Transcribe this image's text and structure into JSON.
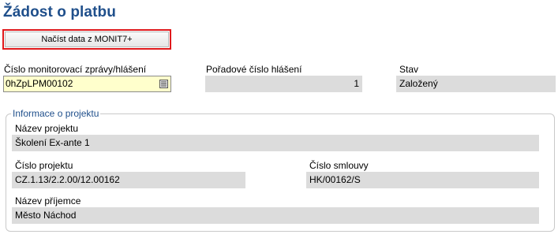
{
  "page": {
    "title": "Žádost o platbu",
    "load_button": "Načíst data z MONIT7+"
  },
  "header_fields": {
    "report_number": {
      "label": "Číslo monitorovací zprávy/hlášení",
      "value": "0hZpLPM00102"
    },
    "sequence_number": {
      "label": "Pořadové číslo hlášení",
      "value": "1"
    },
    "status": {
      "label": "Stav",
      "value": "Založený"
    }
  },
  "project_info": {
    "legend": "Informace o projektu",
    "project_name": {
      "label": "Název projektu",
      "value": "Školení Ex-ante 1"
    },
    "project_number": {
      "label": "Číslo projektu",
      "value": "CZ.1.13/2.2.00/12.00162"
    },
    "contract_number": {
      "label": "Číslo smlouvy",
      "value": "HK/00162/S"
    },
    "recipient_name": {
      "label": "Název příjemce",
      "value": "Město Náchod"
    }
  },
  "icons": {
    "lookup": "list-lookup-icon"
  }
}
